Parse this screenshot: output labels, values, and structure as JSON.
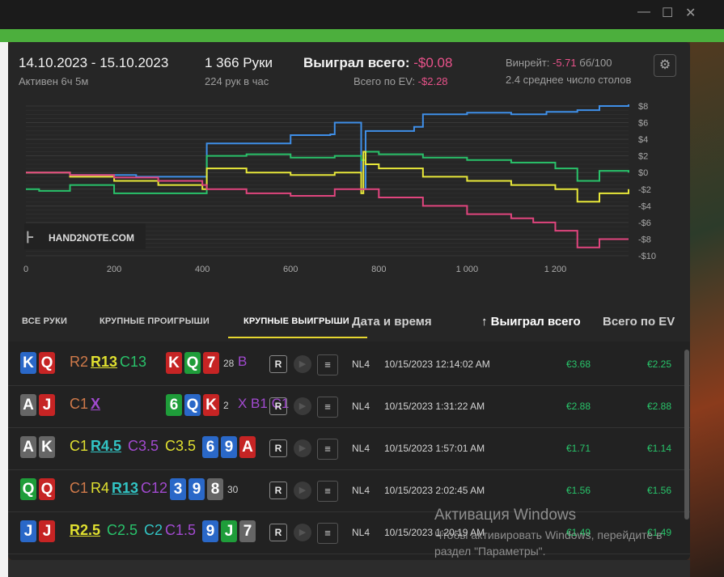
{
  "header": {
    "dates": "14.10.2023 - 15.10.2023",
    "active": "Активен 6ч 5м",
    "hands": "1 366 Руки",
    "hands_rate": "224 рук в час",
    "won_label": "Выиграл всего: ",
    "won_value": "-$0.08",
    "ev_label": "Всего по EV: ",
    "ev_value": "-$2.28",
    "winrate_label": "Винрейт: ",
    "winrate_value": "-5.71",
    "winrate_unit": " бб/100",
    "tables": "2.4 среднее число столов"
  },
  "chart_data": {
    "type": "line",
    "x_ticks": [
      "0",
      "200",
      "400",
      "600",
      "800",
      "1 000",
      "1 200"
    ],
    "y_ticks": [
      "$8",
      "$6",
      "$4",
      "$2",
      "$0",
      "-$2",
      "-$4",
      "-$6",
      "-$8",
      "-$10"
    ],
    "xlim": [
      0,
      1366
    ],
    "ylim": [
      -10,
      8
    ],
    "logo": "HAND2NOTE.COM",
    "series": [
      {
        "color": "#3f8fe8",
        "x": [
          0,
          100,
          250,
          405,
          410,
          600,
          690,
          700,
          760,
          770,
          790,
          880,
          900,
          1000,
          1100,
          1180,
          1250,
          1300,
          1366
        ],
        "y": [
          0,
          -0.3,
          -0.5,
          -0.5,
          3.5,
          4.5,
          4.6,
          6,
          -2,
          5,
          5,
          5.5,
          7,
          7.2,
          7,
          7.3,
          7.5,
          8,
          8.2
        ]
      },
      {
        "color": "#29c26a",
        "x": [
          0,
          30,
          100,
          200,
          300,
          400,
          410,
          500,
          600,
          700,
          760,
          770,
          800,
          900,
          1000,
          1100,
          1200,
          1250,
          1300,
          1366
        ],
        "y": [
          -2,
          -2.2,
          -1.5,
          -2.5,
          -2.5,
          -2.5,
          2,
          2.2,
          1.8,
          2,
          1.5,
          2.5,
          2.2,
          1.8,
          1.5,
          1.2,
          0.5,
          -1,
          0.2,
          0
        ]
      },
      {
        "color": "#e8e83a",
        "x": [
          0,
          100,
          200,
          300,
          400,
          410,
          500,
          600,
          700,
          760,
          765,
          770,
          800,
          900,
          1000,
          1100,
          1200,
          1250,
          1300,
          1366
        ],
        "y": [
          0,
          -0.5,
          -1,
          -1.5,
          -2,
          0.5,
          0,
          -0.3,
          0,
          -2.5,
          2.5,
          1,
          0.5,
          -0.5,
          -1,
          -1.5,
          -2,
          -3.5,
          -2.5,
          -2
        ]
      },
      {
        "color": "#e0457e",
        "x": [
          0,
          100,
          200,
          300,
          400,
          410,
          500,
          600,
          700,
          800,
          900,
          1000,
          1100,
          1150,
          1200,
          1250,
          1300,
          1366
        ],
        "y": [
          0,
          -0.3,
          -0.6,
          -1,
          -1.5,
          -2,
          -2.5,
          -2.8,
          -2,
          -3,
          -4,
          -5,
          -5.5,
          -6,
          -7,
          -9,
          -8,
          -8
        ]
      }
    ]
  },
  "tabs": [
    "ВСЕ РУКИ",
    "КРУПНЫЕ ПРОИГРЫШИ",
    "КРУПНЫЕ ВЫИГРЫШИ"
  ],
  "columns": {
    "date": "Дата и время",
    "won": "↑ Выиграл всего",
    "ev": "Всего по EV"
  },
  "rows": [
    {
      "cards": [
        {
          "r": "K",
          "c": "c-blue"
        },
        {
          "r": "Q",
          "c": "c-red"
        }
      ],
      "actions": [
        {
          "t": "R2",
          "col": "#d07a4a",
          "u": false
        },
        {
          "t": "R13",
          "col": "#e0e030",
          "u": true
        },
        {
          "t": "C13",
          "col": "#29c26a",
          "u": false
        }
      ],
      "board": [
        {
          "r": "K",
          "c": "c-red"
        },
        {
          "r": "Q",
          "c": "c-green"
        },
        {
          "r": "7",
          "c": "c-red"
        }
      ],
      "extra": "28",
      "extra_act": "B",
      "limit": "NL4",
      "date": "10/15/2023 12:14:02 AM",
      "won": "€3.68",
      "ev": "€2.25"
    },
    {
      "cards": [
        {
          "r": "A",
          "c": "c-gray"
        },
        {
          "r": "J",
          "c": "c-red"
        }
      ],
      "actions": [
        {
          "t": "C1",
          "col": "#d07a4a",
          "u": false
        },
        {
          "t": "X",
          "col": "#a24ad0",
          "u": true
        }
      ],
      "board": [
        {
          "r": "6",
          "c": "c-green"
        },
        {
          "r": "Q",
          "c": "c-blue"
        },
        {
          "r": "K",
          "c": "c-red"
        }
      ],
      "extra": "2",
      "extra_act": "X B1 C1",
      "limit": "NL4",
      "date": "10/15/2023 1:31:22 AM",
      "won": "€2.88",
      "ev": "€2.88"
    },
    {
      "cards": [
        {
          "r": "A",
          "c": "c-gray"
        },
        {
          "r": "K",
          "c": "c-gray"
        }
      ],
      "actions": [
        {
          "t": "C1",
          "col": "#e0e030",
          "u": false
        },
        {
          "t": "R4.5",
          "col": "#32c4c4",
          "u": true
        },
        {
          "t": "C3.5",
          "col": "#a24ad0",
          "u": false
        },
        {
          "t": "C3.5",
          "col": "#e0e030",
          "u": false
        }
      ],
      "board": [
        {
          "r": "6",
          "c": "c-blue"
        },
        {
          "r": "9",
          "c": "c-blue"
        },
        {
          "r": "A",
          "c": "c-red"
        }
      ],
      "extra": "",
      "extra_act": "",
      "limit": "NL4",
      "date": "10/15/2023 1:57:01 AM",
      "won": "€1.71",
      "ev": "€1.14"
    },
    {
      "cards": [
        {
          "r": "Q",
          "c": "c-green"
        },
        {
          "r": "Q",
          "c": "c-red"
        }
      ],
      "actions": [
        {
          "t": "C1",
          "col": "#d07a4a",
          "u": false
        },
        {
          "t": "R4",
          "col": "#e0e030",
          "u": false
        },
        {
          "t": "R13",
          "col": "#32c4c4",
          "u": true
        },
        {
          "t": "C12",
          "col": "#a24ad0",
          "u": false
        }
      ],
      "board": [
        {
          "r": "3",
          "c": "c-blue"
        },
        {
          "r": "9",
          "c": "c-blue"
        },
        {
          "r": "8",
          "c": "c-gray"
        }
      ],
      "extra": "30",
      "extra_act": "",
      "limit": "NL4",
      "date": "10/15/2023 2:02:45 AM",
      "won": "€1.56",
      "ev": "€1.56"
    },
    {
      "cards": [
        {
          "r": "J",
          "c": "c-blue"
        },
        {
          "r": "J",
          "c": "c-red"
        }
      ],
      "actions": [
        {
          "t": "R2.5",
          "col": "#e0e030",
          "u": true
        },
        {
          "t": "C2.5",
          "col": "#29c26a",
          "u": false
        },
        {
          "t": "C2",
          "col": "#32c4c4",
          "u": false
        },
        {
          "t": "C1.5",
          "col": "#a24ad0",
          "u": false
        }
      ],
      "board": [
        {
          "r": "9",
          "c": "c-blue"
        },
        {
          "r": "J",
          "c": "c-green"
        },
        {
          "r": "7",
          "c": "c-gray"
        }
      ],
      "extra": "",
      "extra_act": "",
      "limit": "NL4",
      "date": "10/15/2023 1:20:19 AM",
      "won": "€1.49",
      "ev": "€1.49"
    }
  ],
  "row_buttons": {
    "replay": "R"
  },
  "watermark": {
    "line1": "Активация Windows",
    "line2": "Чтобы активировать Windows, перейдите в раздел \"Параметры\"."
  }
}
